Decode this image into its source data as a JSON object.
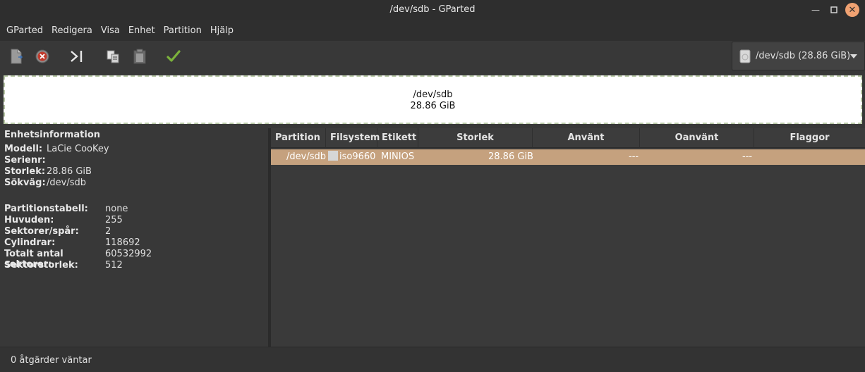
{
  "window": {
    "title": "/dev/sdb - GParted"
  },
  "menu": [
    "GParted",
    "Redigera",
    "Visa",
    "Enhet",
    "Partition",
    "Hjälp"
  ],
  "toolbar": {
    "icons": [
      "new-partition-icon",
      "delete-partition-icon",
      "resize-move-icon",
      "copy-icon",
      "paste-icon",
      "apply-icon"
    ],
    "device_selector": "/dev/sdb (28.86 GiB)"
  },
  "disk_map": {
    "name": "/dev/sdb",
    "size": "28.86 GiB"
  },
  "device_info": {
    "heading": "Enhetsinformation",
    "basic": [
      {
        "key": "Modell:",
        "value": "LaCie CooKey"
      },
      {
        "key": "Serienr:",
        "value": ""
      },
      {
        "key": "Storlek:",
        "value": "28.86 GiB"
      },
      {
        "key": "Sökväg:",
        "value": "/dev/sdb"
      }
    ],
    "geometry": [
      {
        "key": "Partitionstabell:",
        "value": "none"
      },
      {
        "key": "Huvuden:",
        "value": "255"
      },
      {
        "key": "Sektorer/spår:",
        "value": "2"
      },
      {
        "key": "Cylindrar:",
        "value": "118692"
      },
      {
        "key": "Totalt antal sektorer:",
        "value": "60532992"
      },
      {
        "key": "Sektorstorlek:",
        "value": "512"
      }
    ]
  },
  "partition_table": {
    "columns": [
      "Partition",
      "Filsystem",
      "Etikett",
      "Storlek",
      "Använt",
      "Oanvänt",
      "Flaggor"
    ],
    "rows": [
      {
        "partition": "/dev/sdb",
        "filesystem": "iso9660",
        "label": "MINIOS",
        "size": "28.86 GiB",
        "used": "---",
        "unused": "---",
        "flags": ""
      }
    ],
    "selected_row_color": "#c5a17e"
  },
  "status": {
    "text": "0 åtgärder väntar"
  }
}
